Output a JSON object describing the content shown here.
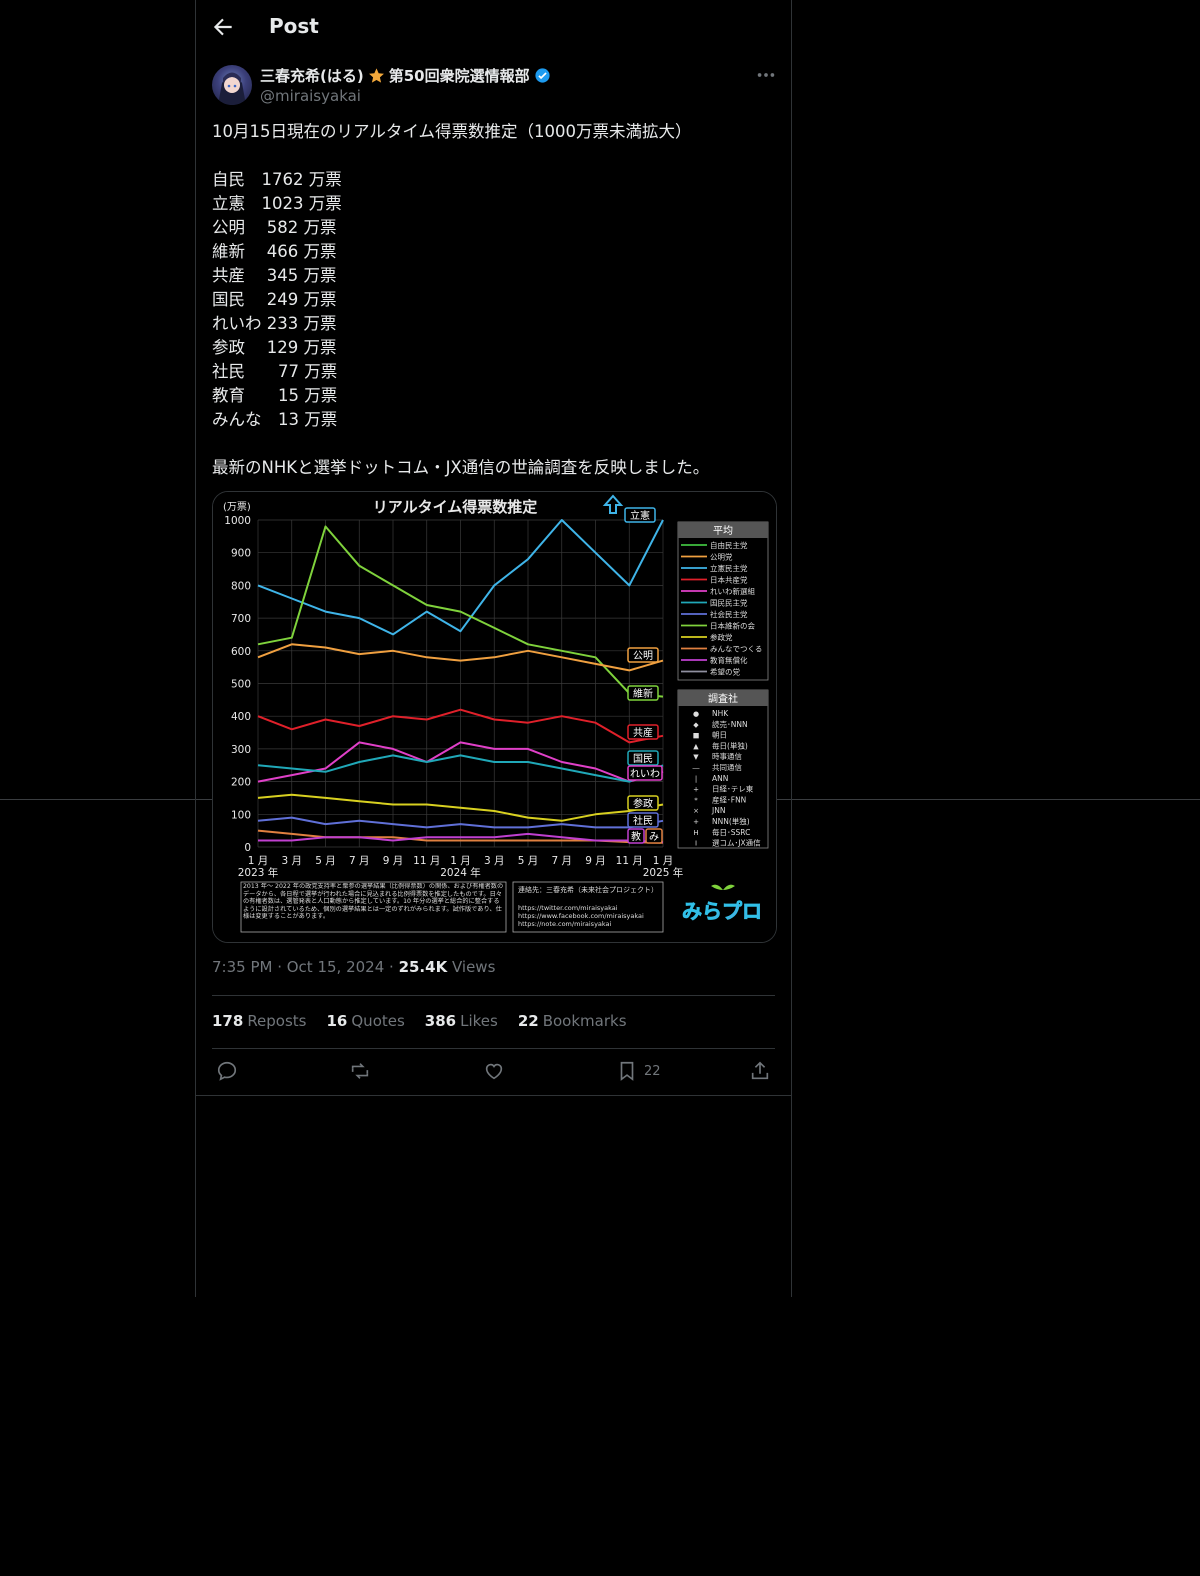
{
  "header": {
    "title": "Post"
  },
  "author": {
    "display_name": "三春充希(はる)",
    "star_icon": "star-emoji",
    "name_suffix": "第50回衆院選情報部",
    "verified": true,
    "handle": "@miraisyakai"
  },
  "post": {
    "lines": [
      "10月15日現在のリアルタイム得票数推定（1000万票未満拡大）",
      "",
      "自民　1762 万票",
      "立憲　1023 万票",
      "公明　 582 万票",
      "維新　 466 万票",
      "共産　 345 万票",
      "国民　 249 万票",
      "れいわ 233 万票",
      "参政　 129 万票",
      "社民　　77 万票",
      "教育　　15 万票",
      "みんな　13 万票",
      "",
      "最新のNHKと選挙ドットコム・JX通信の世論調査を反映しました。"
    ]
  },
  "chart_image": {
    "title": "リアルタイム得票数推定",
    "unit": "(万票)",
    "yticks": [
      "1000",
      "900",
      "800",
      "700",
      "600",
      "500",
      "400",
      "300",
      "200",
      "100",
      "0"
    ],
    "xticks": [
      "1 月",
      "3 月",
      "5 月",
      "7 月",
      "9 月",
      "11 月",
      "1 月",
      "3 月",
      "5 月",
      "7 月",
      "9 月",
      "11 月",
      "1 月"
    ],
    "years": [
      "2023 年",
      "2024 年",
      "2025 年"
    ],
    "party_tags": [
      {
        "label": "立憲",
        "color": "#3fb4e8"
      },
      {
        "label": "公明",
        "color": "#f0a040"
      },
      {
        "label": "維新",
        "color": "#7fd23c"
      },
      {
        "label": "共産",
        "color": "#e0202a"
      },
      {
        "label": "国民",
        "color": "#20a8b8"
      },
      {
        "label": "れいわ",
        "color": "#e040c8"
      },
      {
        "label": "参政",
        "color": "#d8d020"
      },
      {
        "label": "社民",
        "color": "#6070d8"
      },
      {
        "label": "教",
        "color": "#c040d0"
      },
      {
        "label": "み",
        "color": "#e08040"
      }
    ],
    "legend_avg_title": "平均",
    "legend_avg": [
      {
        "label": "自由民主党",
        "color": "#40c040"
      },
      {
        "label": "公明党",
        "color": "#f0a040"
      },
      {
        "label": "立憲民主党",
        "color": "#3fb4e8"
      },
      {
        "label": "日本共産党",
        "color": "#e0202a"
      },
      {
        "label": "れいわ新選組",
        "color": "#e040c8"
      },
      {
        "label": "国民民主党",
        "color": "#20a8b8"
      },
      {
        "label": "社会民主党",
        "color": "#6070d8"
      },
      {
        "label": "日本維新の会",
        "color": "#7fd23c"
      },
      {
        "label": "参政党",
        "color": "#d8d020"
      },
      {
        "label": "みんなでつくる",
        "color": "#e08040"
      },
      {
        "label": "教育無償化",
        "color": "#c040d0"
      },
      {
        "label": "希望の党",
        "color": "#9090a0"
      }
    ],
    "legend_survey_title": "調査社",
    "legend_survey": [
      {
        "mark": "●",
        "label": "NHK"
      },
      {
        "mark": "◆",
        "label": "読売･NNN"
      },
      {
        "mark": "■",
        "label": "朝日"
      },
      {
        "mark": "▲",
        "label": "毎日(単独)"
      },
      {
        "mark": "▼",
        "label": "時事通信"
      },
      {
        "mark": "―",
        "label": "共同通信"
      },
      {
        "mark": "|",
        "label": "ANN"
      },
      {
        "mark": "+",
        "label": "日経･テレ東"
      },
      {
        "mark": "*",
        "label": "産経･FNN"
      },
      {
        "mark": "×",
        "label": "JNN"
      },
      {
        "mark": "+",
        "label": "NNN(単独)"
      },
      {
        "mark": "H",
        "label": "毎日･SSRC"
      },
      {
        "mark": "I",
        "label": "選コム･JX通信"
      }
    ],
    "note_left": "2013 年～ 2022 年の政党支持率と衆参の選挙結果（比例得票数）の関係、および有権者数のデータから、各日程で選挙が行われた場合に見込まれる比例得票数を推定したものです。日々の有権者数は、選管発表と人口動態から推定しています。10 年分の選挙と総合的に整合するように設計されているため、個別の選挙結果とは一定のずれがみられます。試作版であり、仕様は変更することがあります。",
    "note_right_title": "連絡先：三春充希（未来社会プロジェクト）",
    "note_right_links": [
      "https://twitter.com/miraisyakai",
      "https://www.facebook.com/miraisyakai",
      "https://note.com/miraisyakai"
    ],
    "logo_text": "みらプロ"
  },
  "meta": {
    "time": "7:35 PM · Oct 15, 2024 · ",
    "views_count": "25.4K",
    "views_label": " Views"
  },
  "stats": {
    "reposts": "178",
    "reposts_label": "Reposts",
    "quotes": "16",
    "quotes_label": "Quotes",
    "likes": "386",
    "likes_label": "Likes",
    "bookmarks": "22",
    "bookmarks_label": "Bookmarks"
  },
  "actions": {
    "bookmark_count": "22"
  },
  "colors": {
    "background": "#000000",
    "text": "#e7e9ea",
    "muted": "#71767b",
    "border": "#2f3336",
    "verified": "#1d9bf0"
  }
}
